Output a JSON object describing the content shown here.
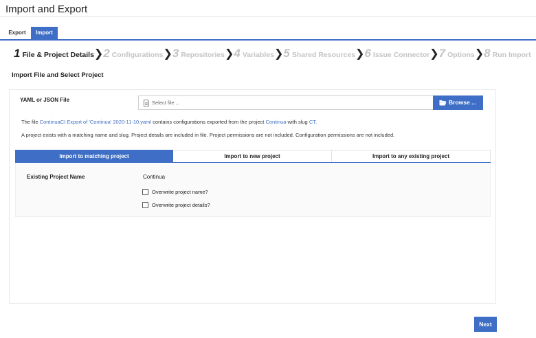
{
  "page": {
    "title": "Import and Export"
  },
  "tabs": {
    "export": "Export",
    "import": "Import"
  },
  "steps": [
    {
      "num": "1",
      "label": "File & Project Details"
    },
    {
      "num": "2",
      "label": "Configurations"
    },
    {
      "num": "3",
      "label": "Repositories"
    },
    {
      "num": "4",
      "label": "Variables"
    },
    {
      "num": "5",
      "label": "Shared Resources"
    },
    {
      "num": "6",
      "label": "Issue Connector"
    },
    {
      "num": "7",
      "label": "Options"
    },
    {
      "num": "8",
      "label": "Run Import"
    }
  ],
  "section": {
    "title": "Import File and Select Project"
  },
  "file": {
    "label": "YAML or JSON File",
    "placeholder": "Select file ...",
    "browse_label": "Browse ..."
  },
  "info": {
    "line1_prefix": "The file ",
    "file_name": "ContinuaCI Export of 'Continua' 2020-11-10.yaml",
    "line1_mid": " contains configurations exported from the project ",
    "project_name": "Continua",
    "line1_slug_text": " with slug ",
    "slug": "CT",
    "line1_end": ".",
    "line2": "A project exists with a matching name and slug. Project details are included in file. Project permissions are not included. Configuration permissions are not included."
  },
  "import_tabs": [
    "Import to matching project",
    "Import to new project",
    "Import to any existing project"
  ],
  "existing": {
    "label": "Existing Project Name",
    "value": "Continua",
    "overwrite_name": "Overwrite project name?",
    "overwrite_details": "Overwrite project details?"
  },
  "buttons": {
    "next": "Next"
  },
  "colors": {
    "accent": "#3e6ec5",
    "inactive_step": "#c4c4c4"
  }
}
